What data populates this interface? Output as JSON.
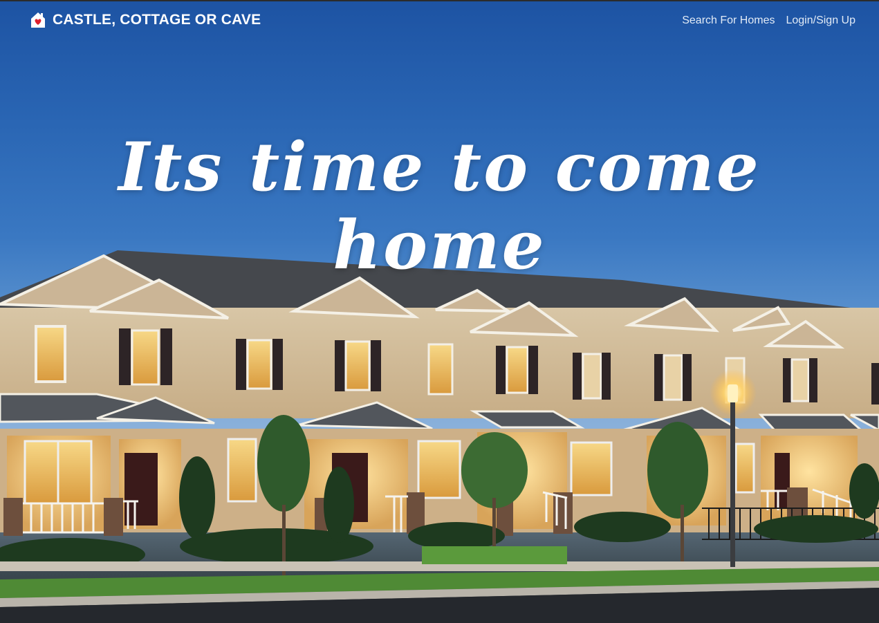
{
  "header": {
    "brand_name": "CASTLE, COTTAGE OR CAVE",
    "logo_icon": "house-heart-icon",
    "nav": [
      {
        "label": "Search For Homes"
      },
      {
        "label": "Login/Sign Up"
      }
    ]
  },
  "hero": {
    "headline": "Its time to come home",
    "image": "townhouse-row-at-dusk"
  },
  "colors": {
    "sky_top": "#1d53a3",
    "sky_bottom": "#8db2da",
    "text": "#ffffff",
    "logo_heart": "#e0202e"
  }
}
